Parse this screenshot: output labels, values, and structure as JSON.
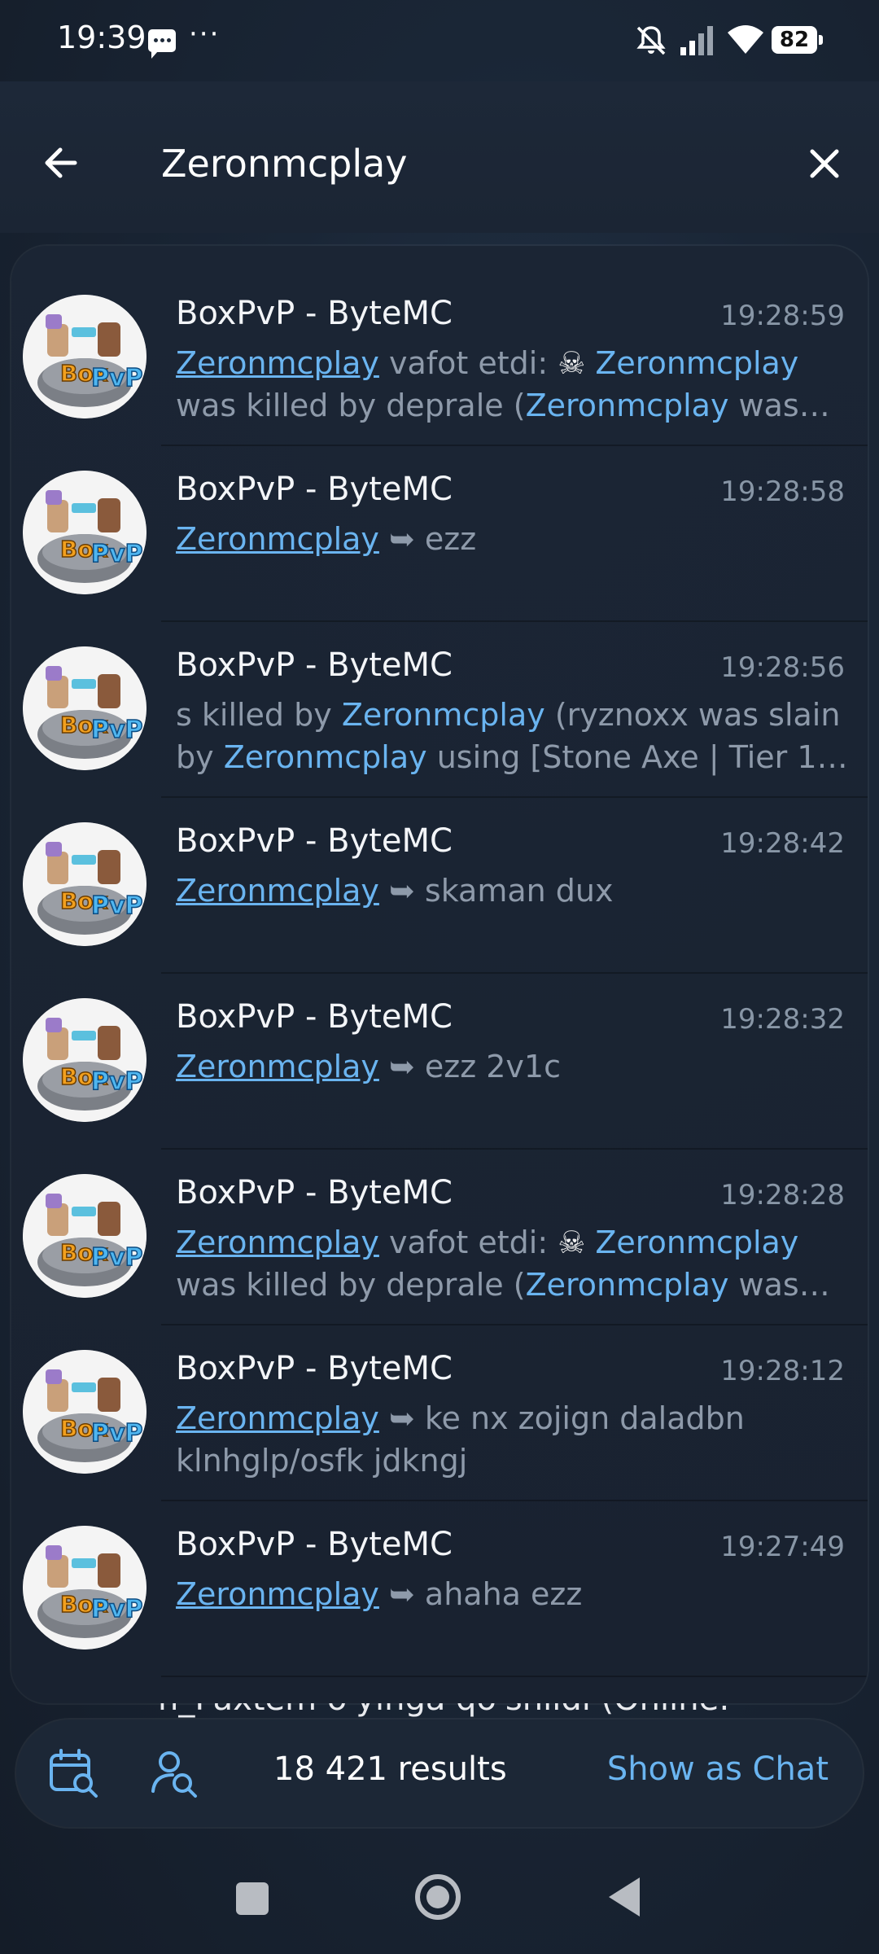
{
  "status_bar": {
    "time": "19:39",
    "battery": "82",
    "icons": [
      "message-icon",
      "more-dots-icon",
      "mute-icon",
      "signal-icon",
      "wifi-icon",
      "battery-icon"
    ]
  },
  "search": {
    "query": "Zeronmcplay",
    "icons": [
      "back-arrow-icon",
      "close-icon"
    ]
  },
  "results": [
    {
      "title": "BoxPvP - ByteMC",
      "time": "19:28:59",
      "lines": [
        [
          {
            "t": "Zeronmcplay",
            "s": "hlu"
          },
          {
            "t": " vafot etdi: ",
            "s": ""
          },
          {
            "t": "☠",
            "s": "skull"
          },
          {
            "t": " ",
            "s": ""
          },
          {
            "t": "Zeronmcplay",
            "s": "hl"
          }
        ],
        [
          {
            "t": "was killed by deprale (",
            "s": ""
          },
          {
            "t": "Zeronmcplay",
            "s": "hl"
          },
          {
            "t": " was…",
            "s": ""
          }
        ]
      ]
    },
    {
      "title": "BoxPvP - ByteMC",
      "time": "19:28:58",
      "lines": [
        [
          {
            "t": "Zeronmcplay",
            "s": "hlu"
          },
          {
            "t": " ➥ ",
            "s": "arrow"
          },
          {
            "t": "ezz",
            "s": ""
          }
        ]
      ]
    },
    {
      "title": "BoxPvP - ByteMC",
      "time": "19:28:56",
      "lines": [
        [
          {
            "t": "s killed by ",
            "s": ""
          },
          {
            "t": "Zeronmcplay",
            "s": "hl"
          },
          {
            "t": " (ryznoxx was slain",
            "s": ""
          }
        ],
        [
          {
            "t": "by ",
            "s": ""
          },
          {
            "t": "Zeronmcplay",
            "s": "hl"
          },
          {
            "t": " using [Stone Axe | Tier 1])…",
            "s": ""
          }
        ]
      ]
    },
    {
      "title": "BoxPvP - ByteMC",
      "time": "19:28:42",
      "lines": [
        [
          {
            "t": "Zeronmcplay",
            "s": "hlu"
          },
          {
            "t": " ➥ ",
            "s": "arrow"
          },
          {
            "t": "skaman dux",
            "s": ""
          }
        ]
      ]
    },
    {
      "title": "BoxPvP - ByteMC",
      "time": "19:28:32",
      "lines": [
        [
          {
            "t": "Zeronmcplay",
            "s": "hlu"
          },
          {
            "t": " ➥ ",
            "s": "arrow"
          },
          {
            "t": "ezz 2v1c",
            "s": ""
          }
        ]
      ]
    },
    {
      "title": "BoxPvP - ByteMC",
      "time": "19:28:28",
      "lines": [
        [
          {
            "t": "Zeronmcplay",
            "s": "hlu"
          },
          {
            "t": " vafot etdi: ",
            "s": ""
          },
          {
            "t": "☠",
            "s": "skull"
          },
          {
            "t": " ",
            "s": ""
          },
          {
            "t": "Zeronmcplay",
            "s": "hl"
          }
        ],
        [
          {
            "t": "was killed by deprale (",
            "s": ""
          },
          {
            "t": "Zeronmcplay",
            "s": "hl"
          },
          {
            "t": " was…",
            "s": ""
          }
        ]
      ]
    },
    {
      "title": "BoxPvP - ByteMC",
      "time": "19:28:12",
      "lines": [
        [
          {
            "t": "Zeronmcplay",
            "s": "hlu"
          },
          {
            "t": " ➥ ",
            "s": "arrow"
          },
          {
            "t": "ke nx zojign daladbn",
            "s": ""
          }
        ],
        [
          {
            "t": "klnhglp/osfk jdkngj",
            "s": ""
          }
        ]
      ]
    },
    {
      "title": "BoxPvP - ByteMC",
      "time": "19:27:49",
      "lines": [
        [
          {
            "t": "Zeronmcplay",
            "s": "hlu"
          },
          {
            "t": " ➥ ",
            "s": "arrow"
          },
          {
            "t": "ahaha ezz",
            "s": ""
          }
        ]
      ]
    }
  ],
  "peek_text": "n_Paxtem o'yinga qo'shildi (Online:",
  "bottom_bar": {
    "result_count": "18 421 results",
    "show_as_chat": "Show as Chat",
    "icons": [
      "calendar-search-icon",
      "user-search-icon"
    ]
  },
  "nav_bar": {
    "icons": [
      "recents-icon",
      "home-icon",
      "back-icon"
    ]
  },
  "colors": {
    "accent": "#6ab4f0",
    "background": "#1a2636",
    "muted_text": "#8e9aaa"
  }
}
